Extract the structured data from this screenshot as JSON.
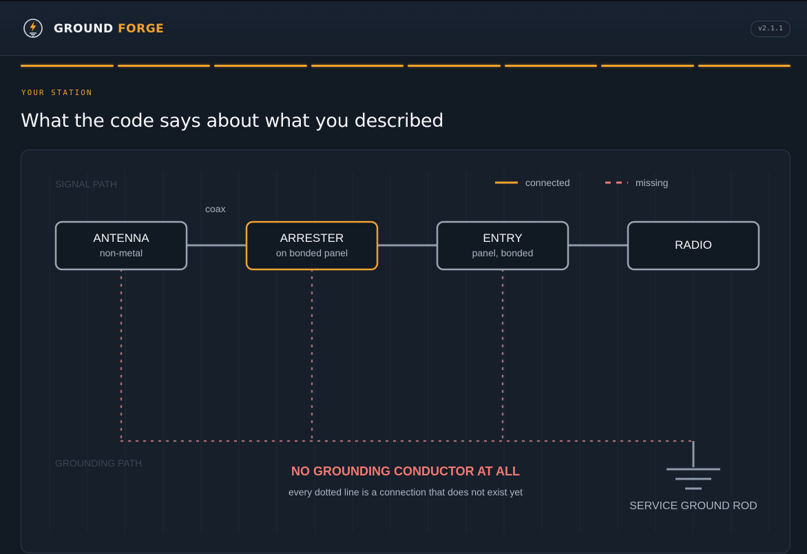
{
  "app": {
    "brand_first": "GROUND",
    "brand_second": "FORGE",
    "version": "v2.1.1",
    "progress_steps_complete": 8,
    "progress_steps_total": 8,
    "logo_icon": "lightning-bolt-ground-icon"
  },
  "page": {
    "eyebrow": "YOUR STATION",
    "title": "What the code says about what you described"
  },
  "diagram": {
    "signal_path_label": "SIGNAL PATH",
    "grounding_path_label": "GROUNDING PATH",
    "legend": {
      "connected": "connected",
      "missing": "missing"
    },
    "coax_label": "coax",
    "nodes": [
      {
        "title": "ANTENNA",
        "subtitle": "non-metal",
        "highlight": false
      },
      {
        "title": "ARRESTER",
        "subtitle": "on bonded panel",
        "highlight": true
      },
      {
        "title": "ENTRY",
        "subtitle": "panel, bonded",
        "highlight": false
      },
      {
        "title": "RADIO",
        "subtitle": "",
        "highlight": false
      }
    ],
    "warning_title": "NO GROUNDING CONDUCTOR AT ALL",
    "warning_subtitle": "every dotted line is a connection that does not exist yet",
    "ground_rod_label": "SERVICE GROUND ROD",
    "colors": {
      "accent": "#f0a22e",
      "missing": "#e8797a",
      "node_border": "#9aa6b5",
      "warning": "#f07a72"
    }
  }
}
